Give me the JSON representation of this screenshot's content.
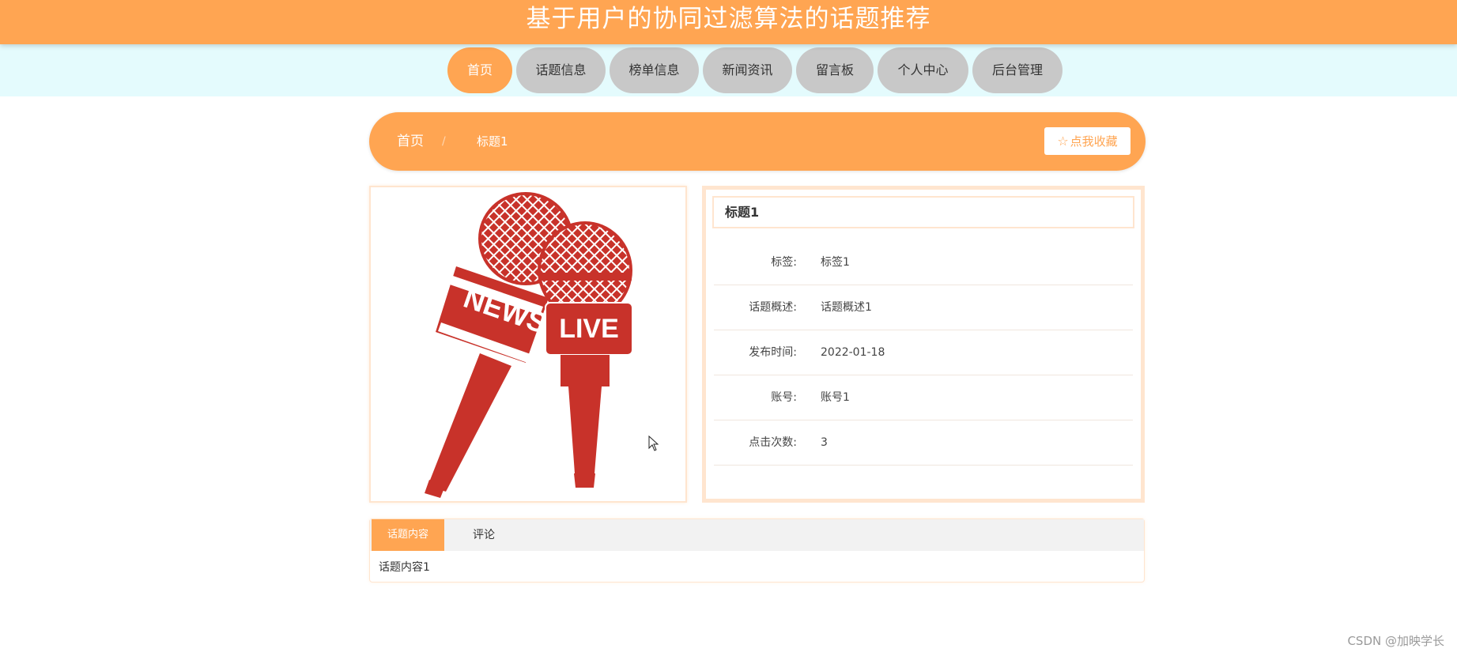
{
  "header": {
    "title": "基于用户的协同过滤算法的话题推荐"
  },
  "nav": {
    "items": [
      {
        "label": "首页",
        "active": true
      },
      {
        "label": "话题信息"
      },
      {
        "label": "榜单信息"
      },
      {
        "label": "新闻资讯"
      },
      {
        "label": "留言板"
      },
      {
        "label": "个人中心"
      },
      {
        "label": "后台管理"
      }
    ]
  },
  "breadcrumb": {
    "home": "首页",
    "separator": "/",
    "current": "标题1",
    "favorite_label": "点我收藏"
  },
  "image": {
    "news_label": "NEWS",
    "live_label": "LIVE"
  },
  "detail": {
    "title": "标题1",
    "rows": [
      {
        "label": "标签:",
        "value": "标签1"
      },
      {
        "label": "话题概述:",
        "value": "话题概述1"
      },
      {
        "label": "发布时间:",
        "value": "2022-01-18"
      },
      {
        "label": "账号:",
        "value": "账号1"
      },
      {
        "label": "点击次数:",
        "value": "3"
      }
    ]
  },
  "tabs": {
    "items": [
      {
        "label": "话题内容",
        "active": true
      },
      {
        "label": "评论"
      }
    ],
    "content": "话题内容1"
  },
  "watermark": "CSDN @加映学长",
  "colors": {
    "accent": "#ffa552",
    "nav_bg": "#e4fbfd",
    "inactive_nav": "#c8c8c8",
    "mic_red": "#c8322a"
  }
}
